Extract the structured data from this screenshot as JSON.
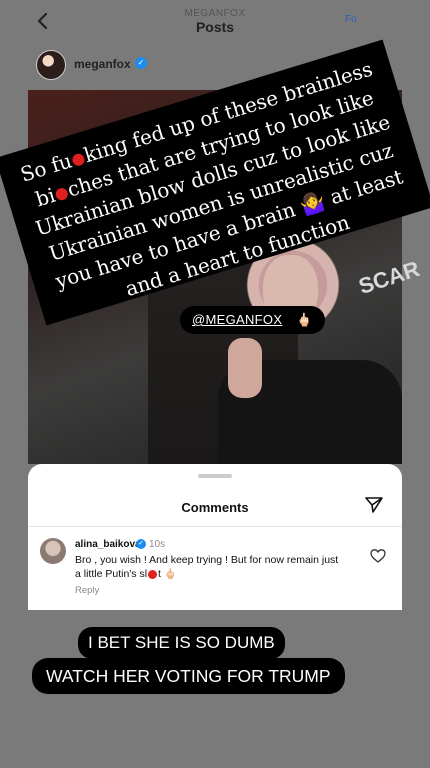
{
  "header": {
    "username_small": "MEGANFOX",
    "title": "Posts",
    "right_fragment": "Fo"
  },
  "profile": {
    "username": "meganfox",
    "verified": "✓"
  },
  "photo": {
    "shirt_text": "SCAR"
  },
  "banner": {
    "part1": "So fu",
    "part2": "king fed up of these brainless bi",
    "part3": "ches that are trying to look like Ukrainian blow dolls cuz to look like Ukrainian women is unrealistic cuz you have to have a brain 🤷‍♀️ at least and a heart to function"
  },
  "mention": {
    "label": "@MEGANFOX",
    "emoji": "🖕🏻"
  },
  "comments": {
    "title": "Comments",
    "item": {
      "user": "alina_baikova",
      "verified": "✓",
      "time": "10s",
      "text_a": "Bro , you wish ! And keep trying ! But for now remain just a little Putin's sl",
      "text_b": "t 🖕🏻",
      "reply": "Reply"
    }
  },
  "caption": {
    "line1": "I BET SHE IS SO  DUMB",
    "line2": "WATCH HER VOTING FOR TRUMP"
  },
  "colors": {
    "verified_blue": "#1d8cf0",
    "censor_red": "#e0201f"
  }
}
